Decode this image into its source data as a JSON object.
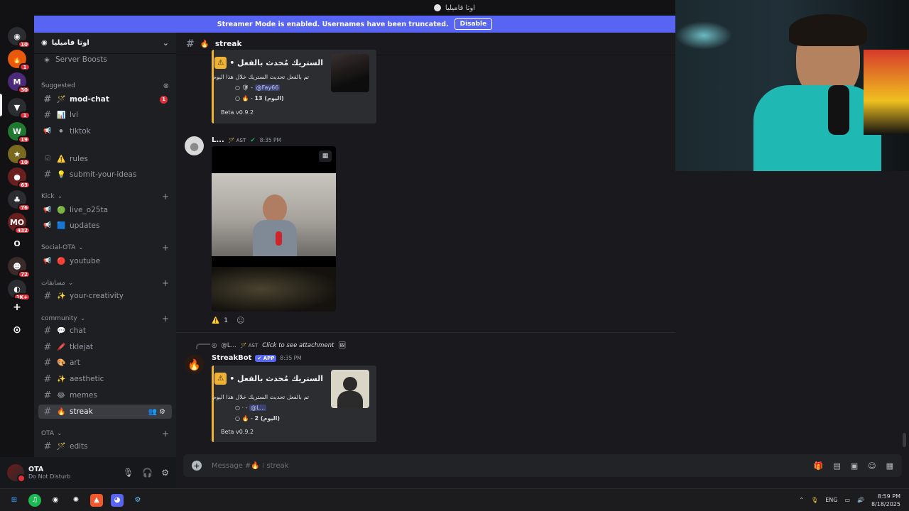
{
  "window": {
    "title": "اوتا فاميليا"
  },
  "banner": {
    "text": "Streamer Mode is enabled. Usernames have been truncated.",
    "disable_label": "Disable"
  },
  "servers": [
    {
      "badge": "10",
      "color": "#2b2d31",
      "glyph": "◉"
    },
    {
      "badge": "1",
      "color": "#e8590c",
      "glyph": "🔥"
    },
    {
      "badge": "30",
      "color": "#4c2a7a",
      "glyph": "M"
    },
    {
      "badge": "1",
      "color": "#2b2d31",
      "glyph": "▼"
    },
    {
      "badge": "19",
      "color": "#1f7a2f",
      "glyph": "W"
    },
    {
      "badge": "10",
      "color": "#7a6a1f",
      "glyph": "★"
    },
    {
      "badge": "63",
      "color": "#6a1f1f",
      "glyph": "●"
    },
    {
      "badge": "76",
      "color": "#2b2d31",
      "glyph": "♣"
    },
    {
      "badge": "432",
      "color": "#6a1f1f",
      "glyph": "MO"
    },
    {
      "badge": "",
      "color": "#121214",
      "glyph": "O"
    },
    {
      "badge": "72",
      "color": "#3a2a2a",
      "glyph": "☻"
    },
    {
      "badge": "1K+",
      "color": "#2b2d31",
      "glyph": "◐"
    }
  ],
  "guild": {
    "name": "اوتا فاميليا"
  },
  "sidebar": {
    "server_boosts": "Server Boosts",
    "suggested_label": "Suggested",
    "channels": [
      {
        "type": "text",
        "emoji": "🪄",
        "name": "mod-chat",
        "badge": "1",
        "unread": true
      },
      {
        "type": "text",
        "emoji": "📊",
        "name": "lvl"
      },
      {
        "type": "announce",
        "emoji": "⚫",
        "name": "tiktok"
      },
      {
        "type": "rules",
        "emoji": "⚠️",
        "name": "rules"
      },
      {
        "type": "text",
        "emoji": "💡",
        "name": "submit-your-ideas"
      },
      {
        "type": "announce",
        "emoji": "🟢",
        "name": "live_o25ta"
      },
      {
        "type": "announce",
        "emoji": "🟦",
        "name": "updates"
      },
      {
        "type": "announce",
        "emoji": "🔴",
        "name": "youtube"
      },
      {
        "type": "text",
        "emoji": "✨",
        "name": "your-creativity"
      },
      {
        "type": "text",
        "emoji": "💬",
        "name": "chat"
      },
      {
        "type": "text",
        "emoji": "🖍️",
        "name": "tklejat"
      },
      {
        "type": "text",
        "emoji": "🎨",
        "name": "art"
      },
      {
        "type": "text",
        "emoji": "✨",
        "name": "aesthetic"
      },
      {
        "type": "text",
        "emoji": "😂",
        "name": "memes"
      },
      {
        "type": "text",
        "emoji": "🔥",
        "name": "streak",
        "active": true
      },
      {
        "type": "text",
        "emoji": "🪄",
        "name": "edits"
      }
    ],
    "categories": [
      "Kick",
      "Social-OTA",
      "مسابقات",
      "community",
      "OTA"
    ]
  },
  "user": {
    "name": "OTA",
    "status": "Do Not Disturb"
  },
  "channel_header": {
    "emoji": "🔥",
    "name": "streak"
  },
  "messages": {
    "embed1": {
      "title": "الستريك مُحدث بالفعل •",
      "line1": "تم بالفعل تحديث الستريك خلال هذا اليوم",
      "mention": "@Fay66",
      "count": "13 (اليوم)",
      "footer": "Beta v0.9.2"
    },
    "msg2": {
      "author": "L...",
      "tag": "AST",
      "time": "8:35 PM",
      "reaction_count": "1"
    },
    "msg3": {
      "reply_author": "@L...",
      "reply_tag": "AST",
      "reply_text": "Click to see attachment",
      "author": "StreakBot",
      "app_tag": "APP",
      "time": "8:35 PM",
      "embed": {
        "title": "الستريك مُحدث بالفعل •",
        "line1": "تم بالفعل تحديث الستريك خلال هذا اليوم",
        "mention": "@L...",
        "count": "2 (اليوم)",
        "footer": "Beta v0.9.2"
      }
    }
  },
  "composer": {
    "placeholder": "Message #🔥 ⁝ streak"
  },
  "taskbar": {
    "lang": "ENG",
    "time": "8:59 PM",
    "date": "8/18/2025"
  },
  "colors": {
    "accent": "#5865f2",
    "embed_border": "#f0b232",
    "badge": "#e0313a"
  }
}
